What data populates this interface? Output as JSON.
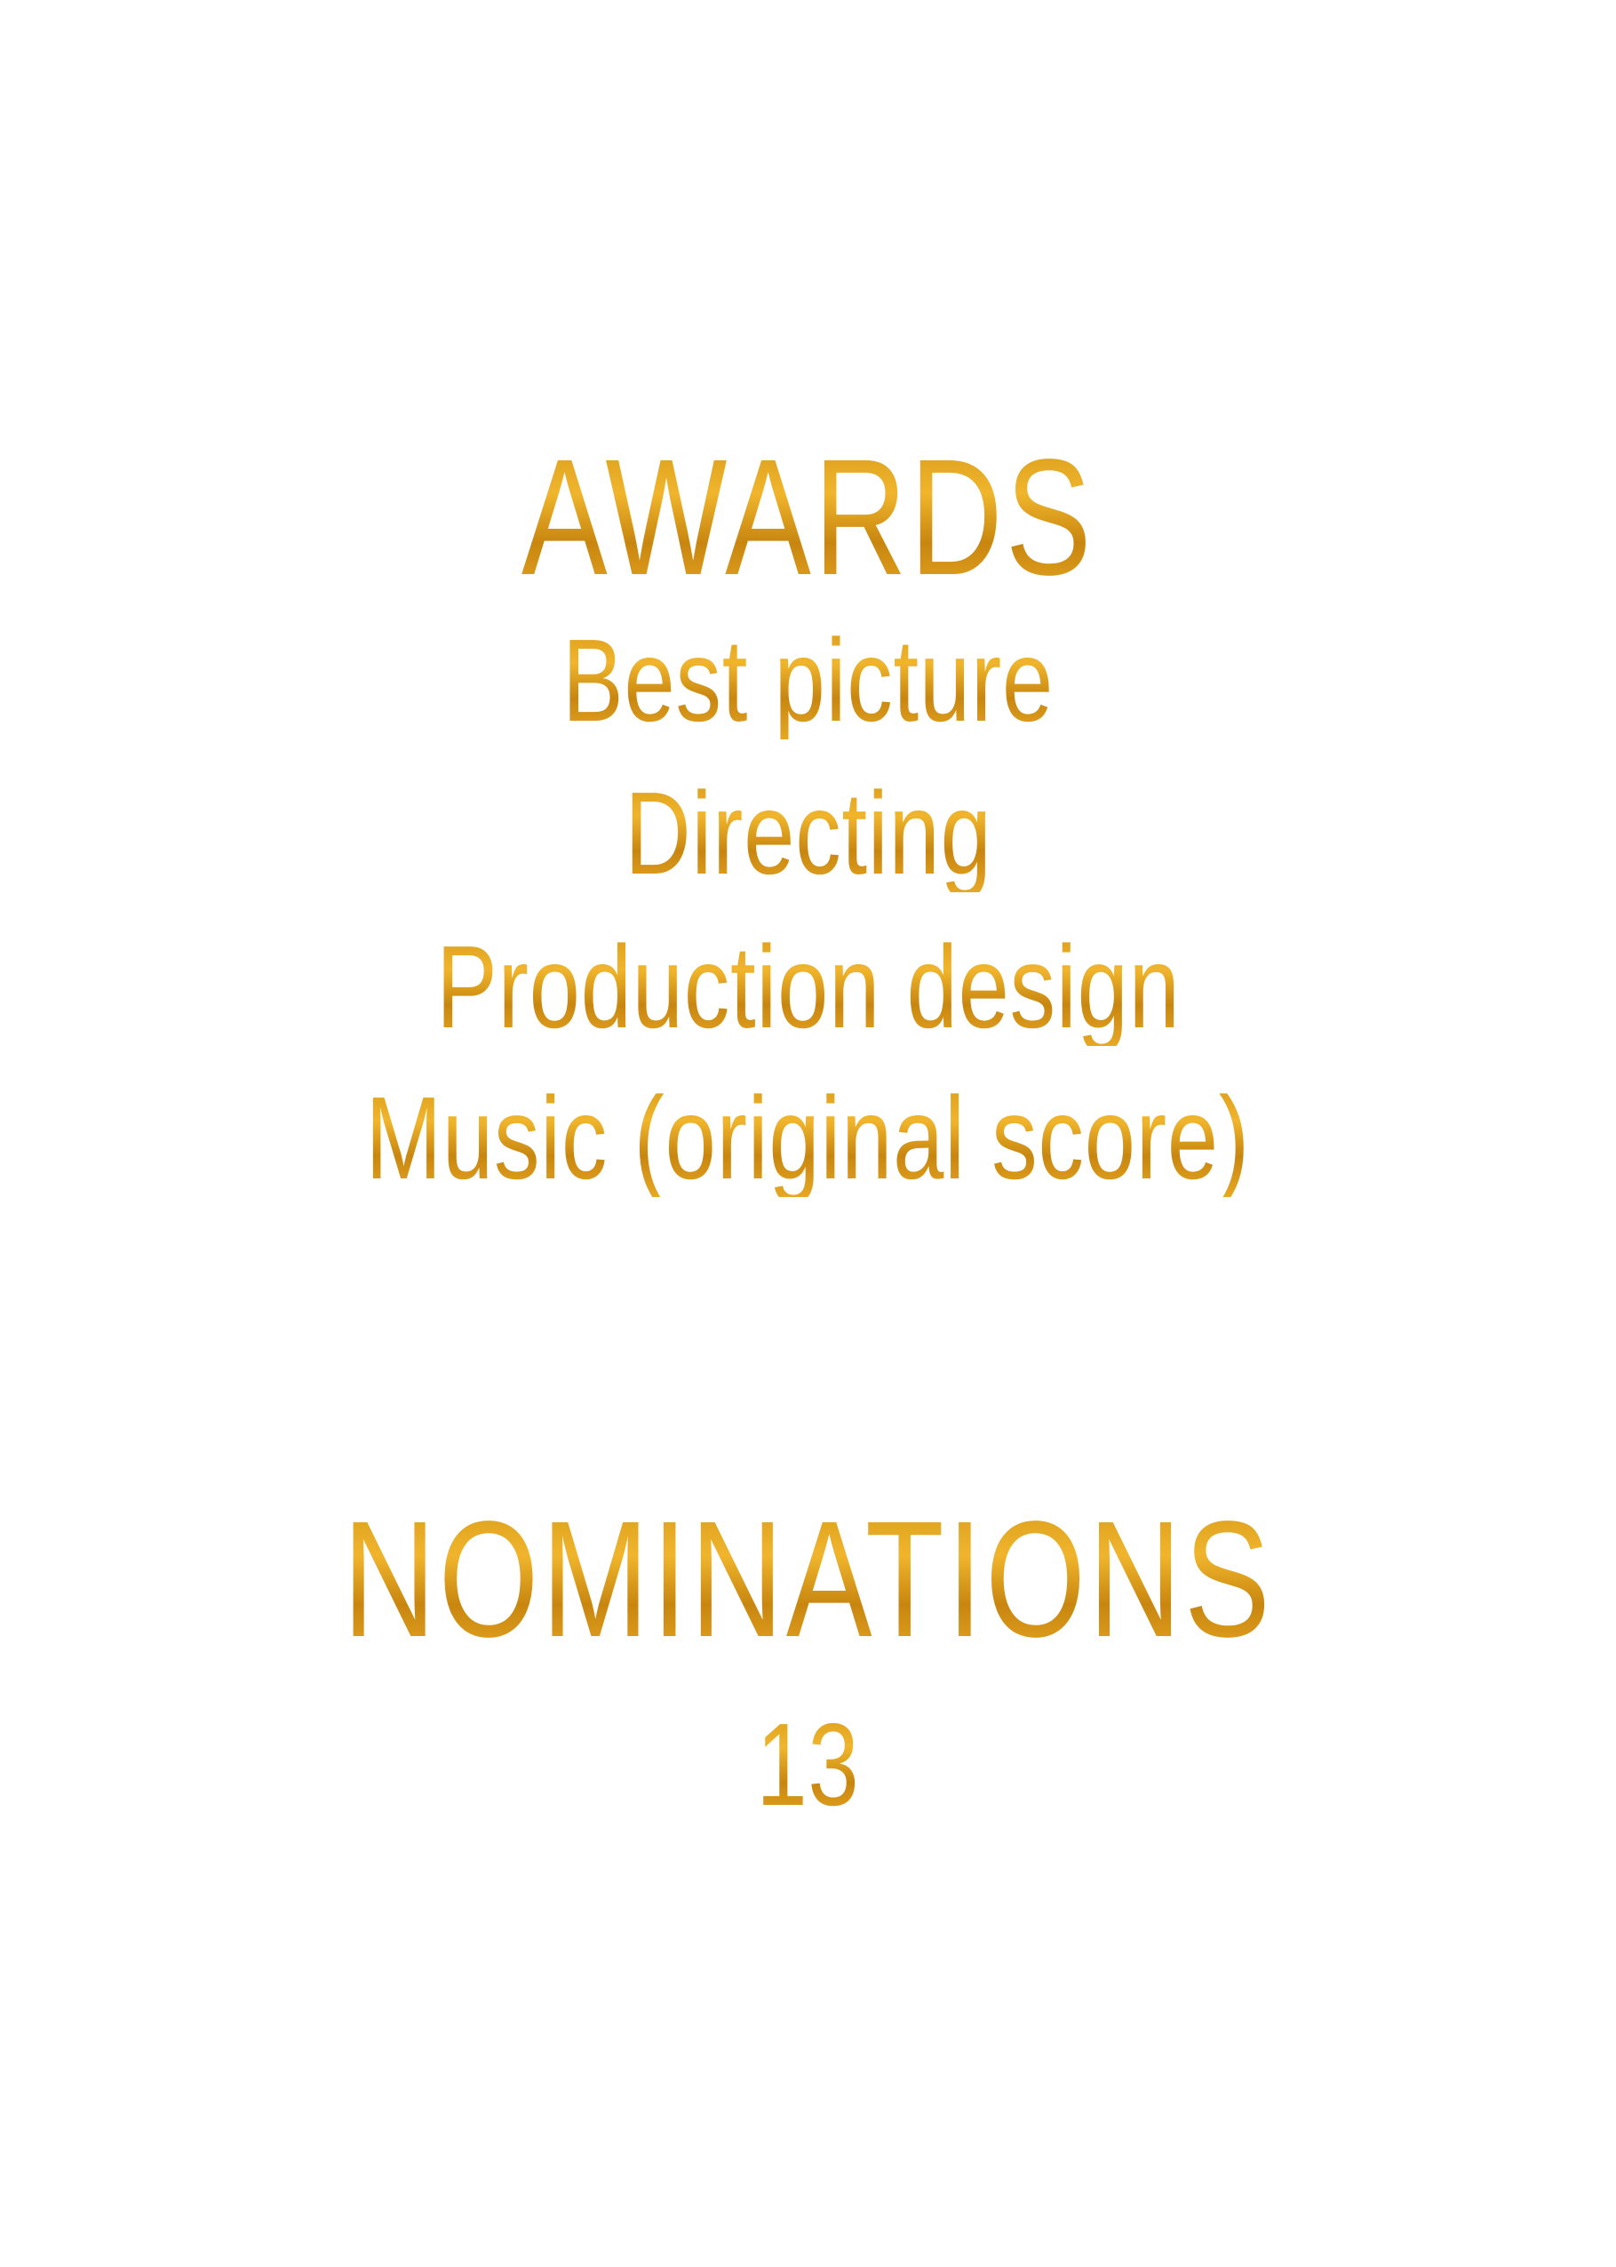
{
  "awards": {
    "heading": "AWARDS",
    "items": [
      "Best picture",
      "Directing",
      "Production design",
      "Music (original score)"
    ]
  },
  "nominations": {
    "heading": "NOMINATIONS",
    "count": "13"
  },
  "colors": {
    "text_gold": "#e0a020",
    "background": "#ffffff"
  }
}
